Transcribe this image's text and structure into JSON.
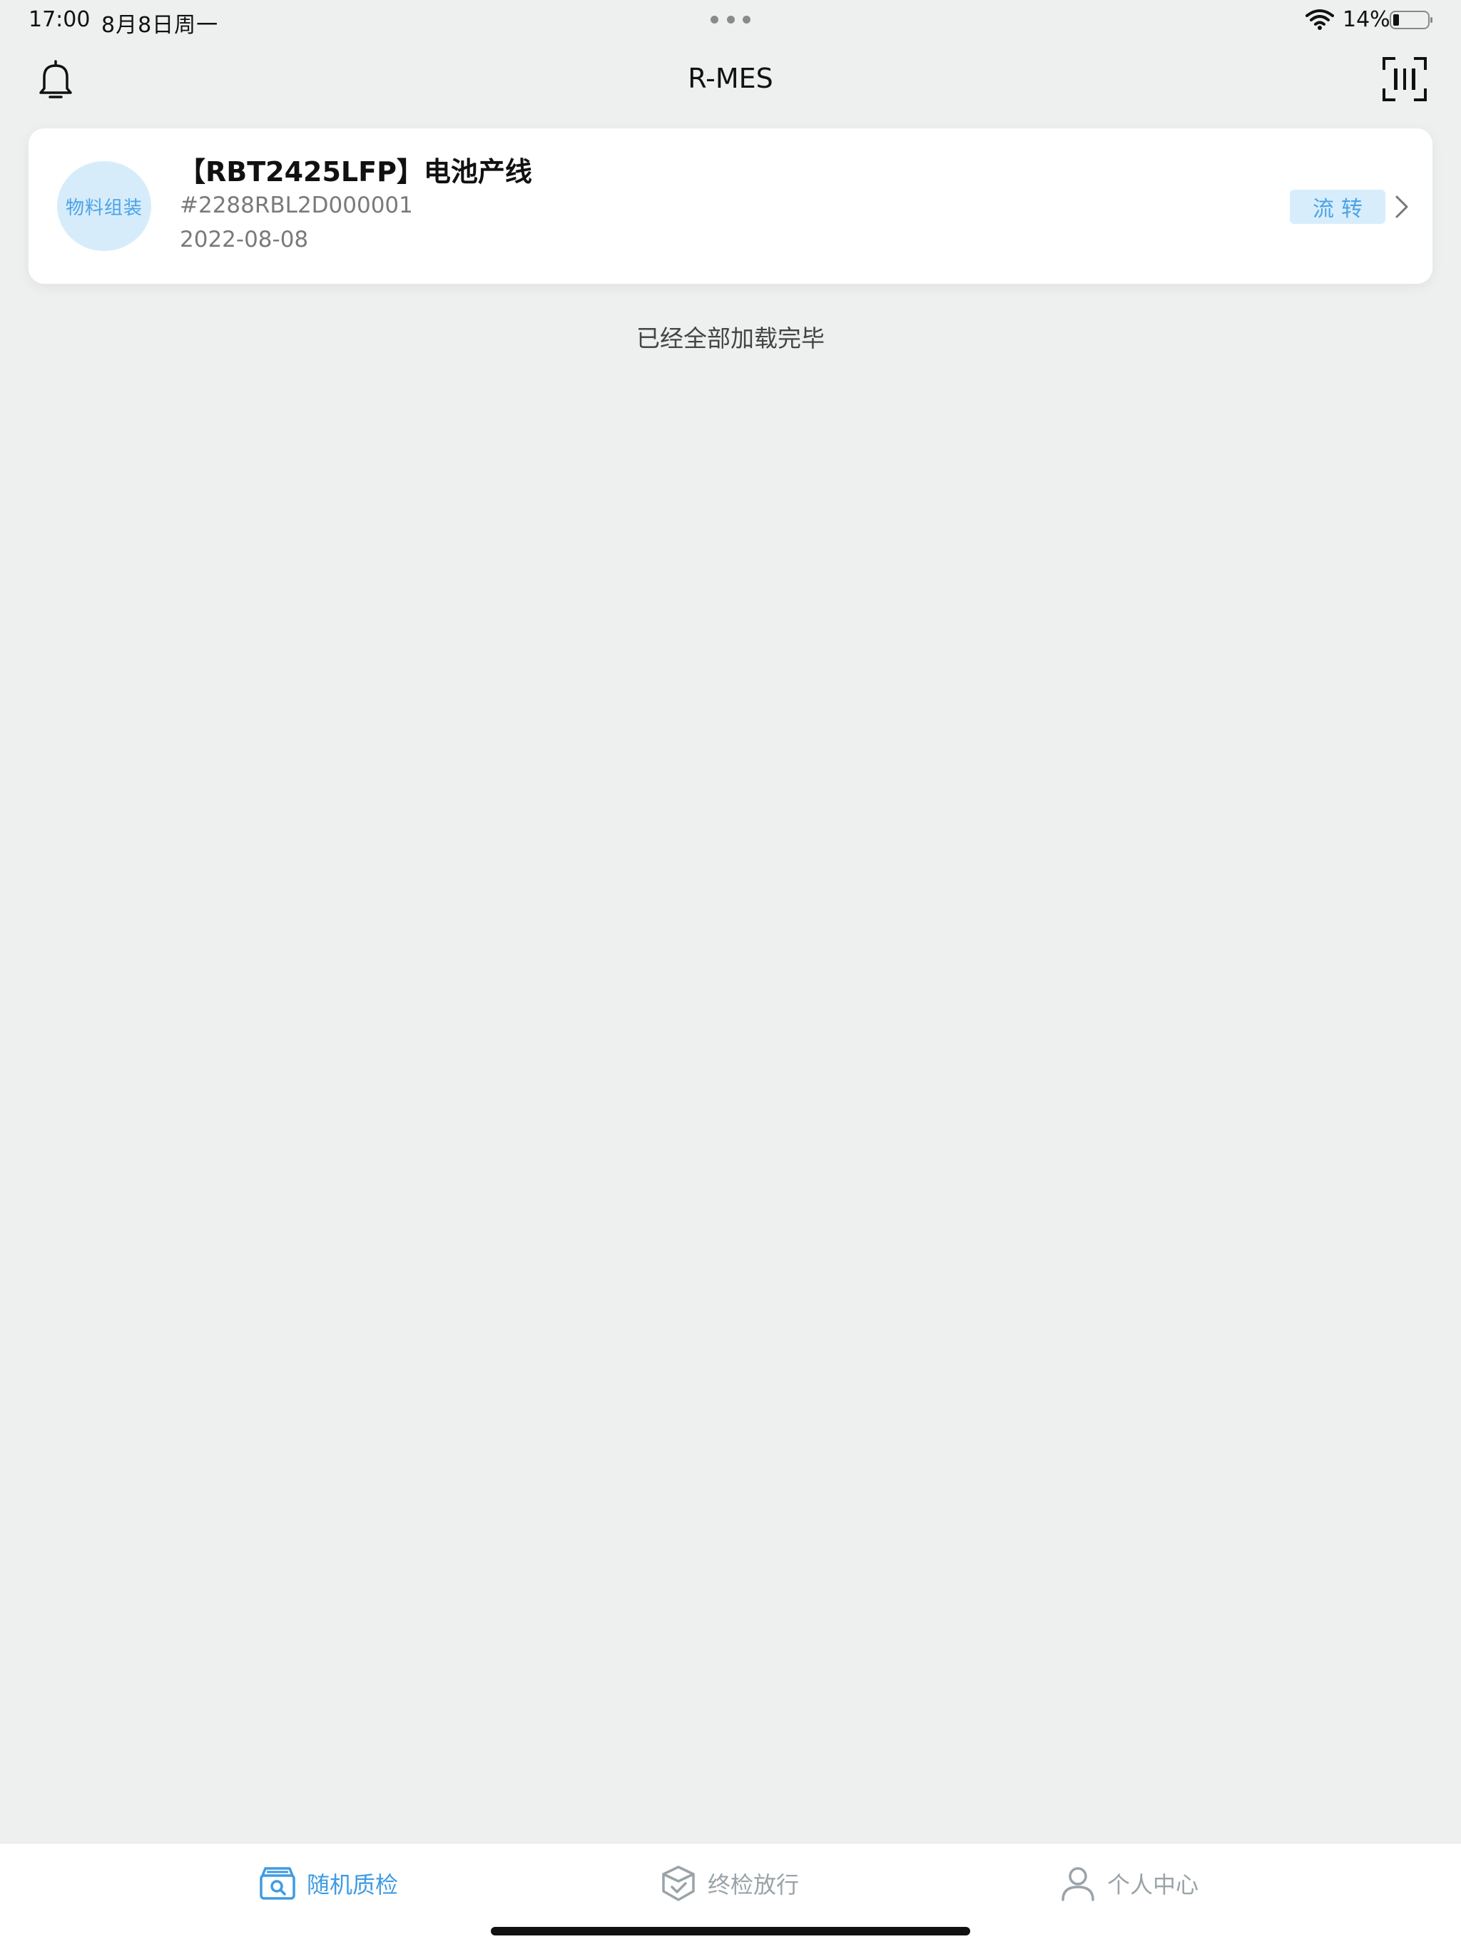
{
  "status_bar": {
    "time": "17:00",
    "date": "8月8日周一",
    "battery": "14%"
  },
  "header": {
    "title": "R-MES",
    "left_icon": "bell-icon",
    "right_icon": "barcode-scan-icon"
  },
  "orders": [
    {
      "avatar_label": "物料组装",
      "title": "【RBT2425LFP】电池产线",
      "code": "#2288RBL2D000001",
      "date": "2022-08-08",
      "status": "流转"
    }
  ],
  "list_footer": "已经全部加载完毕",
  "tabs": [
    {
      "label": "随机质检",
      "icon": "inspection-box-icon",
      "active": true
    },
    {
      "label": "终检放行",
      "icon": "shield-check-icon",
      "active": false
    },
    {
      "label": "个人中心",
      "icon": "person-icon",
      "active": false
    }
  ],
  "colors": {
    "accent": "#3f9be3",
    "accent_light": "#d8edfc",
    "background": "#eef0f0",
    "inactive": "#9aa3a8"
  }
}
